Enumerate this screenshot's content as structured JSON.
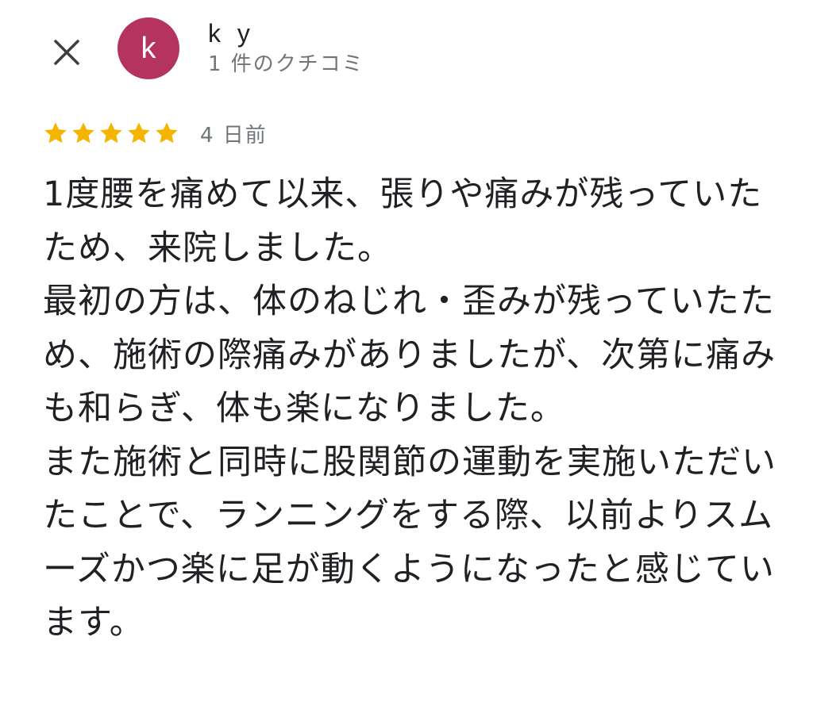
{
  "header": {
    "close_icon": "close-icon",
    "avatar_letter": "k",
    "avatar_color": "#b5335f",
    "user_name": "k y",
    "review_count": "1 件のクチコミ"
  },
  "review": {
    "rating": 5,
    "rating_max": 5,
    "star_color": "#f4b400",
    "date": "4 日前",
    "text": "1度腰を痛めて以来、張りや痛みが残っていたため、来院しました。\n最初の方は、体のねじれ・歪みが残っていたため、施術の際痛みがありましたが、次第に痛みも和らぎ、体も楽になりました。\nまた施術と同時に股関節の運動を実施いただいたことで、ランニングをする際、以前よりスムーズかつ楽に足が動くようになったと感じています。"
  }
}
